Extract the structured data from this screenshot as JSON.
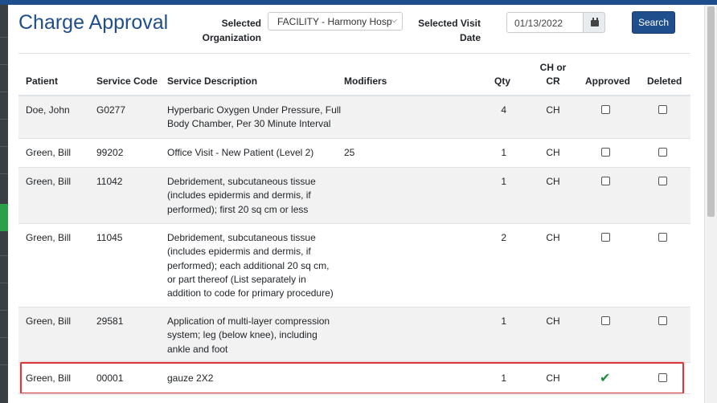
{
  "title": "Charge Approval",
  "filters": {
    "org_label_1": "Selected",
    "org_label_2": "Organization",
    "org_value": "FACILITY - Harmony Hosp",
    "date_label_1": "Selected Visit",
    "date_label_2": "Date",
    "date_value": "01/13/2022",
    "search_label": "Search"
  },
  "columns": {
    "patient": "Patient",
    "service_code": "Service Code",
    "service_description": "Service Description",
    "modifiers": "Modifiers",
    "qty": "Qty",
    "ch_cr_1": "CH or",
    "ch_cr_2": "CR",
    "approved": "Approved",
    "deleted": "Deleted"
  },
  "rows": [
    {
      "patient": "Doe, John",
      "code": "G0277",
      "desc": [
        "Hyperbaric Oxygen Under Pressure, Full",
        "Body Chamber, Per 30 Minute Interval"
      ],
      "modifiers": "",
      "qty": "4",
      "chcr": "CH",
      "approved": false,
      "deleted": false
    },
    {
      "patient": "Green, Bill",
      "code": "99202",
      "desc": [
        "Office Visit - New Patient (Level 2)"
      ],
      "modifiers": "25",
      "qty": "1",
      "chcr": "CH",
      "approved": false,
      "deleted": false
    },
    {
      "patient": "Green, Bill",
      "code": "11042",
      "desc": [
        "Debridement, subcutaneous tissue",
        "(includes epidermis and dermis, if",
        "performed); first 20 sq cm or less"
      ],
      "modifiers": "",
      "qty": "1",
      "chcr": "CH",
      "approved": false,
      "deleted": false
    },
    {
      "patient": "Green, Bill",
      "code": "11045",
      "desc": [
        "Debridement, subcutaneous tissue",
        "(includes epidermis and dermis, if",
        "performed); each additional 20 sq cm,",
        "or part thereof (List separately in",
        "addition to code for primary procedure)"
      ],
      "modifiers": "",
      "qty": "2",
      "chcr": "CH",
      "approved": false,
      "deleted": false
    },
    {
      "patient": "Green, Bill",
      "code": "29581",
      "desc": [
        "Application of multi-layer compression",
        "system; leg (below knee), including",
        "ankle and foot"
      ],
      "modifiers": "",
      "qty": "1",
      "chcr": "CH",
      "approved": false,
      "deleted": false
    },
    {
      "patient": "Green, Bill",
      "code": "00001",
      "desc": [
        "gauze 2X2"
      ],
      "modifiers": "",
      "qty": "1",
      "chcr": "CH",
      "approved": true,
      "deleted": false
    }
  ],
  "colors": {
    "brand": "#1f4e8c",
    "highlight": "#d8383a",
    "approved_check": "#1e8a3c"
  },
  "icons": {
    "date_picker": "calendar-icon",
    "approved_mark": "check-icon",
    "select": "chevron-down-icon"
  }
}
